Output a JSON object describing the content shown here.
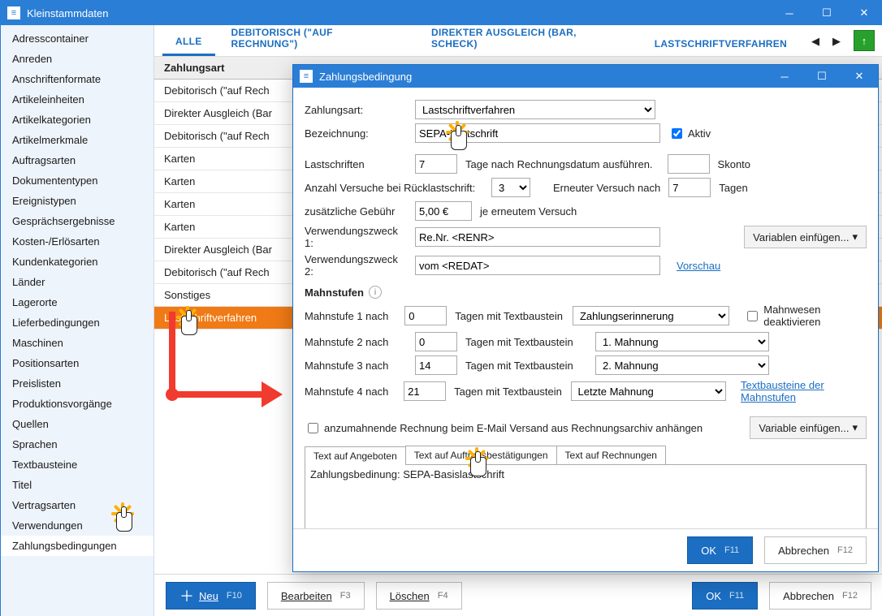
{
  "window": {
    "title": "Kleinstammdaten"
  },
  "sidebar": {
    "items": [
      "Adresscontainer",
      "Anreden",
      "Anschriftenformate",
      "Artikeleinheiten",
      "Artikelkategorien",
      "Artikelmerkmale",
      "Auftragsarten",
      "Dokumententypen",
      "Ereignistypen",
      "Gesprächsergebnisse",
      "Kosten-/Erlösarten",
      "Kundenkategorien",
      "Länder",
      "Lagerorte",
      "Lieferbedingungen",
      "Maschinen",
      "Positionsarten",
      "Preislisten",
      "Produktionsvorgänge",
      "Quellen",
      "Sprachen",
      "Textbausteine",
      "Titel",
      "Vertragsarten",
      "Verwendungen",
      "Zahlungsbedingungen"
    ],
    "selected": "Zahlungsbedingungen"
  },
  "tabs": {
    "items": [
      "ALLE",
      "DEBITORISCH (\"AUF RECHNUNG\")",
      "DIREKTER AUSGLEICH (BAR, SCHECK)",
      "LASTSCHRIFTVERFAHREN"
    ],
    "active": 0
  },
  "list": {
    "header": "Zahlungsart",
    "rows": [
      "Debitorisch (\"auf Rech",
      "Direkter Ausgleich (Bar",
      "Debitorisch (\"auf Rech",
      "Karten",
      "Karten",
      "Karten",
      "Karten",
      "Direkter Ausgleich (Bar",
      "Debitorisch (\"auf Rech",
      "Sonstiges",
      "Lastschriftverfahren"
    ],
    "selected": 10
  },
  "footer": {
    "neu": "Neu",
    "neu_kb": "F10",
    "bearb": "Bearbeiten",
    "bearb_kb": "F3",
    "del": "Löschen",
    "del_kb": "F4",
    "ok": "OK",
    "ok_kb": "F11",
    "cancel": "Abbrechen",
    "cancel_kb": "F12"
  },
  "dlg": {
    "title": "Zahlungsbedingung",
    "labels": {
      "zahlungsart": "Zahlungsart:",
      "bezeichnung": "Bezeichnung:",
      "aktiv": "Aktiv",
      "lastschriften": "Lastschriften",
      "tage_nach": "Tage nach Rechnungsdatum ausführen.",
      "skonto": "Skonto",
      "anzahl_versuche": "Anzahl Versuche bei Rücklastschrift:",
      "erneut_nach": "Erneuter Versuch nach",
      "tagen": "Tagen",
      "zus_gebuehr": "zusätzliche Gebühr",
      "je_versuch": "je erneutem Versuch",
      "vz1": "Verwendungszweck 1:",
      "vz2": "Verwendungszweck 2:",
      "vorschau": "Vorschau",
      "var_einf": "Variablen einfügen...",
      "mahnstufen": "Mahnstufen",
      "ms_nach": [
        "Mahnstufe 1 nach",
        "Mahnstufe 2 nach",
        "Mahnstufe 3 nach",
        "Mahnstufe 4 nach"
      ],
      "tagen_tb": "Tagen mit Textbaustein",
      "mahn_deakt": "Mahnwesen deaktivieren",
      "tb_link": "Textbausteine der Mahnstufen",
      "anhang": "anzumahnende Rechnung beim E-Mail Versand aus Rechnungsarchiv anhängen",
      "var_einf2": "Variable einfügen...",
      "txttabs": [
        "Text auf Angeboten",
        "Text auf Auftragsbestätigungen",
        "Text auf Rechnungen"
      ],
      "ok": "OK",
      "ok_kb": "F11",
      "cancel": "Abbrechen",
      "cancel_kb": "F12"
    },
    "values": {
      "zahlungsart": "Lastschriftverfahren",
      "bezeichnung": "SEPA-Lastschrift",
      "aktiv": true,
      "lastschriften_tage": "7",
      "skonto": "",
      "rueck_versuche": "3",
      "erneut_tage": "7",
      "gebuehr": "5,00 €",
      "vz1": "Re.Nr. <RENR>",
      "vz2": "vom <REDAT>",
      "ms_tage": [
        "0",
        "0",
        "14",
        "21"
      ],
      "ms_baustein": [
        "Zahlungserinnerung",
        "1. Mahnung",
        "2. Mahnung",
        "Letzte Mahnung"
      ],
      "mahn_deakt": false,
      "anhang": false,
      "text": "Zahlungsbedinung: SEPA-Basislastschrift"
    }
  }
}
